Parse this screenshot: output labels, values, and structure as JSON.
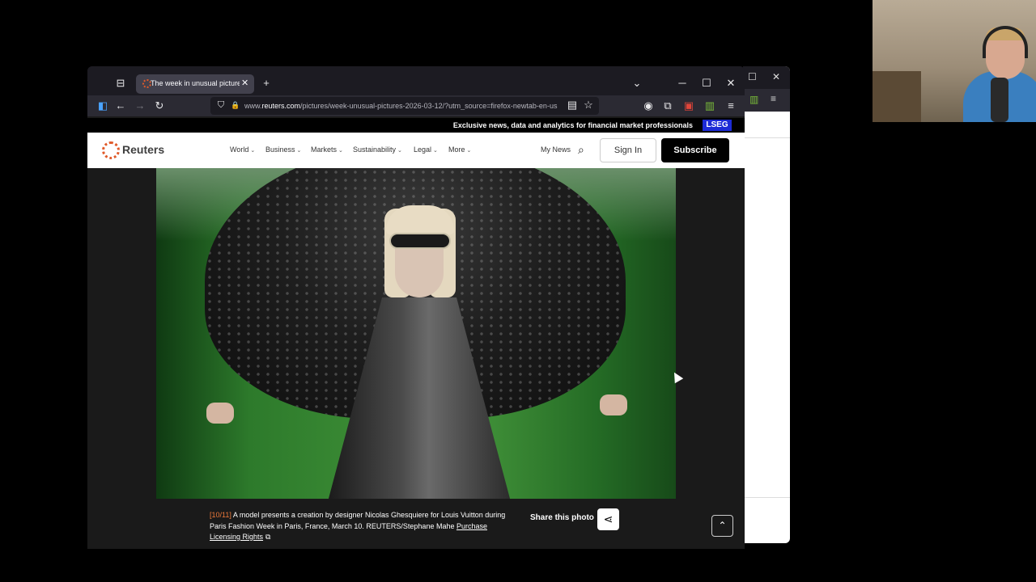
{
  "browser": {
    "tab_title": "The week in unusual pictures - R",
    "url_prefix": "www.",
    "url_domain": "reuters.com",
    "url_path": "/pictures/week-unusual-pictures-2026-03-12/?utm_source=firefox-newtab-en-us"
  },
  "icons": {
    "tab_close": "✕",
    "new_tab": "+",
    "list_tabs": "⌄",
    "minimize": "─",
    "maximize": "☐",
    "close": "✕",
    "sidebar": "◧",
    "back": "←",
    "forward": "→",
    "reload": "↻",
    "shield": "⛉",
    "lock": "🔒",
    "reader": "▤",
    "star": "☆",
    "account": "◉",
    "extensions": "⧉",
    "ext_badge": "▣",
    "ext_meter": "▥",
    "menu": "≡",
    "search": "⌕",
    "share": "⋖",
    "up": "⌃",
    "external": "⧉",
    "chevron": "⌄"
  },
  "site": {
    "promo_text": "Exclusive news, data and analytics for financial market professionals",
    "lseg": "LSEG",
    "logo": "Reuters",
    "nav": [
      "World",
      "Business",
      "Markets",
      "Sustainability",
      "Legal",
      "More"
    ],
    "my_news": "My News",
    "sign_in": "Sign In",
    "subscribe": "Subscribe"
  },
  "caption": {
    "index": "[10/11]",
    "text": " A model presents a creation by designer Nicolas Ghesquiere for Louis Vuitton during Paris Fashion Week in Paris, France, March 10. REUTERS/Stephane Mahe ",
    "link": "Purchase Licensing Rights"
  },
  "share": {
    "label": "Share this photo"
  },
  "colors": {
    "accent": "#f07a3a",
    "lseg_blue": "#1d2bd6",
    "browser_dark": "#1c1b22"
  }
}
